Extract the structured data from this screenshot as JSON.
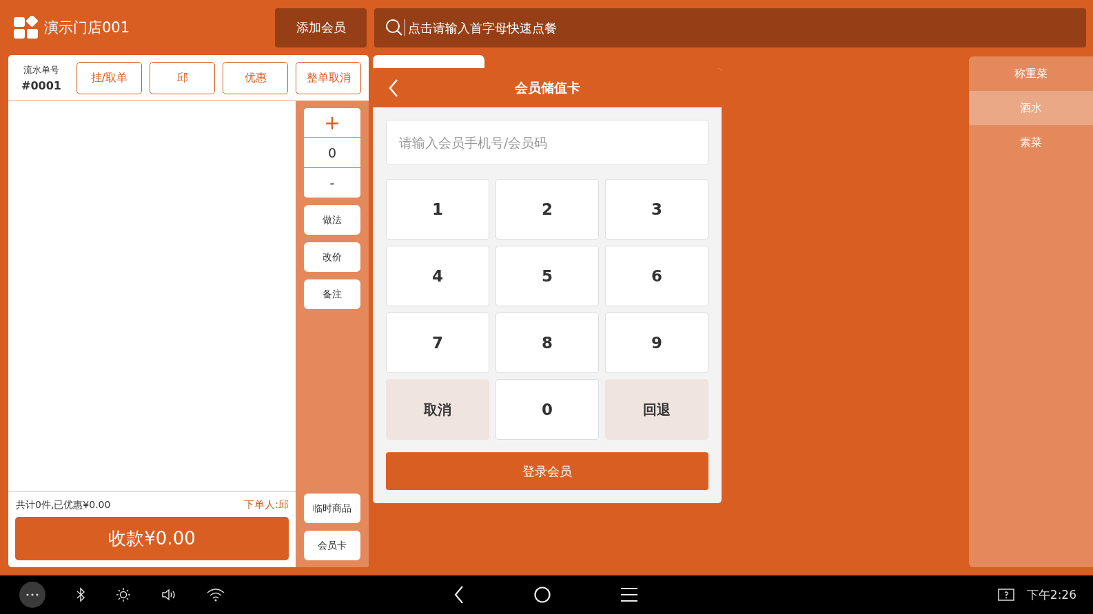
{
  "header": {
    "store_name": "演示门店001",
    "add_member_button": "添加会员",
    "search": {
      "placeholder": "点击请输入首字母快速点餐"
    }
  },
  "order": {
    "serial_label": "流水单号",
    "serial_number": "#0001",
    "actions": [
      "挂/取单",
      "邱",
      "优惠",
      "整单取消"
    ],
    "quantity": "0",
    "quantity_plus": "+",
    "quantity_minus": "-",
    "tools": [
      "做法",
      "改价",
      "备注"
    ],
    "bottom_tools": [
      "临时商品",
      "会员卡"
    ],
    "summary": "共计0件,已优惠¥0.00",
    "orderer": "下单人:邱",
    "pay_button": "收款¥0.00"
  },
  "products": [
    {
      "kind": "card"
    }
  ],
  "member_dialog": {
    "title": "会员储值卡",
    "input": {
      "placeholder": "请输入会员手机号/会员码"
    },
    "keys": [
      {
        "label": "1",
        "kind": "digit"
      },
      {
        "label": "2",
        "kind": "digit"
      },
      {
        "label": "3",
        "kind": "digit"
      },
      {
        "label": "4",
        "kind": "digit"
      },
      {
        "label": "5",
        "kind": "digit"
      },
      {
        "label": "6",
        "kind": "digit"
      },
      {
        "label": "7",
        "kind": "digit"
      },
      {
        "label": "8",
        "kind": "digit"
      },
      {
        "label": "9",
        "kind": "digit"
      },
      {
        "label": "取消",
        "kind": "action"
      },
      {
        "label": "0",
        "kind": "digit"
      },
      {
        "label": "回退",
        "kind": "action"
      }
    ],
    "login_button": "登录会员"
  },
  "categories": [
    {
      "label": "称重菜",
      "selected": false
    },
    {
      "label": "酒水",
      "selected": true
    },
    {
      "label": "素菜",
      "selected": false
    }
  ],
  "system_bar": {
    "time": "下午2:26"
  }
}
